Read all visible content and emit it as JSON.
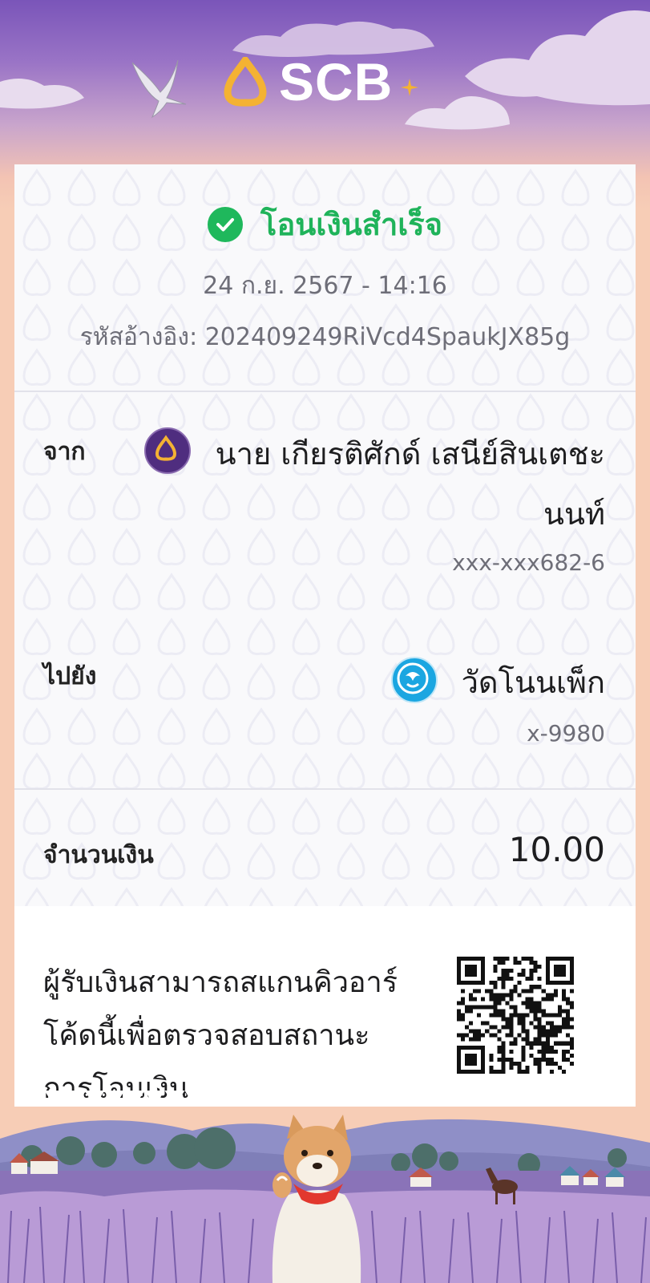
{
  "brand": {
    "name": "SCB",
    "colors": {
      "gold": "#f4b233",
      "purple": "#4f2d7f",
      "success": "#1fb85c"
    }
  },
  "status": {
    "icon": "check-circle-icon",
    "text": "โอนเงินสำเร็จ"
  },
  "datetime": "24 ก.ย. 2567 - 14:16",
  "reference": {
    "label": "รหัสอ้างอิง:",
    "value": "202409249RiVcd4SpaukJX85g"
  },
  "from": {
    "label": "จาก",
    "bank_icon": "scb-bank-icon",
    "name_line1": "นาย เกียรติศักด์ เสนีย์สินเตชะ",
    "name_line2": "นนท์",
    "account": "xxx-xxx682-6"
  },
  "to": {
    "label": "ไปยัง",
    "bank_icon": "ktb-bank-icon",
    "name": "วัดโนนเพ็ก",
    "account": "x-9980"
  },
  "amount": {
    "label": "จำนวนเงิน",
    "value": "10.00"
  },
  "verify_note": {
    "line1": "ผู้รับเงินสามารถสแกนคิวอาร์",
    "line2": "โค้ดนี้เพื่อตรวจสอบสถานะ",
    "line3": "การโอนเงิน"
  }
}
